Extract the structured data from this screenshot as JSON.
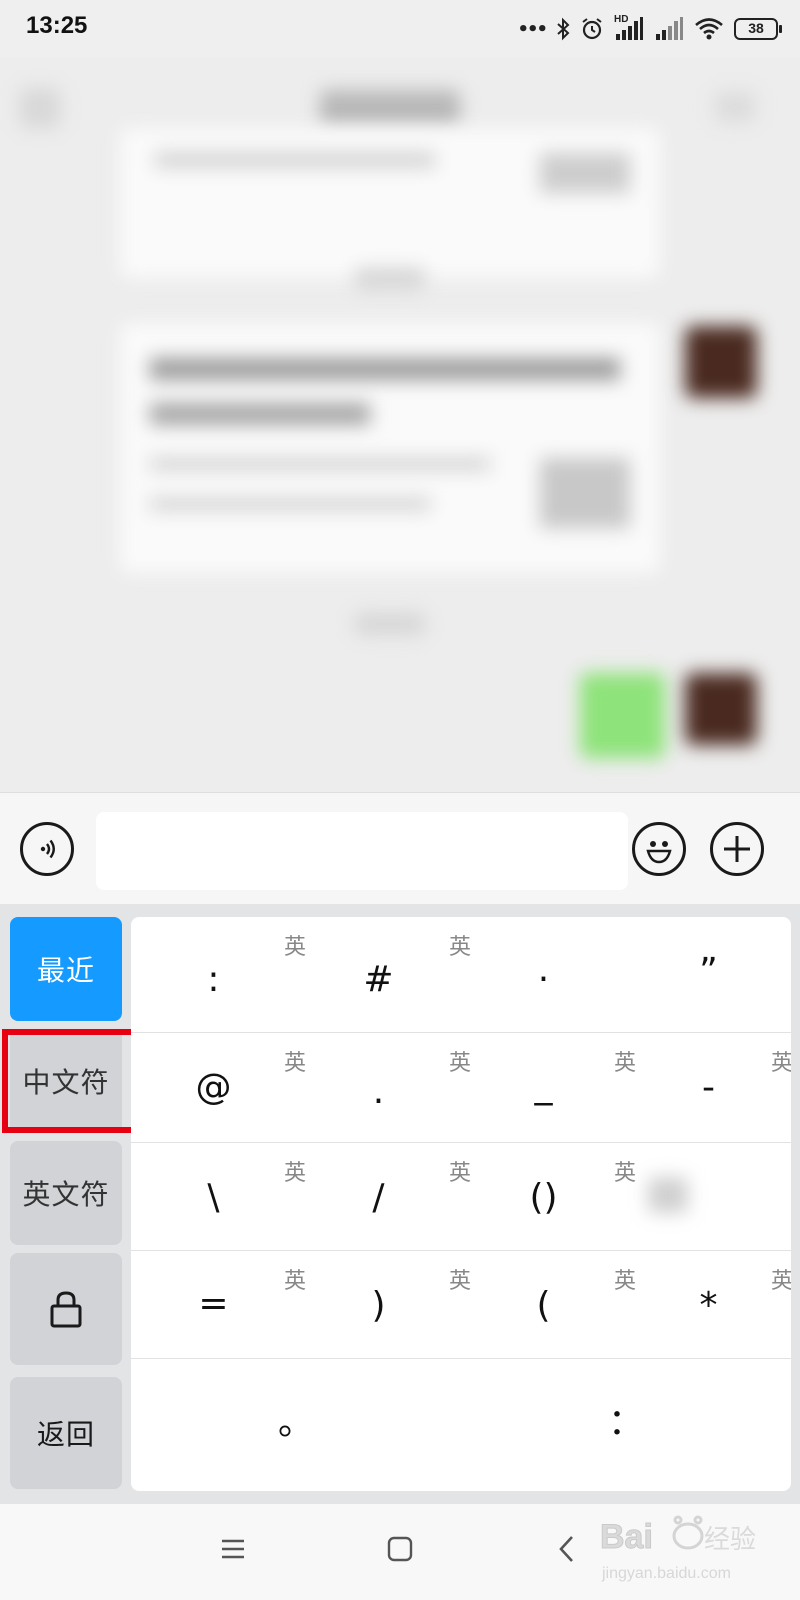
{
  "status_bar": {
    "time": "13:25",
    "dots": "•••",
    "network_label": "HD",
    "battery": "38",
    "icons": [
      "bluetooth-icon",
      "alarm-icon",
      "signal-hd-icon",
      "signal-icon",
      "wifi-icon",
      "battery-icon"
    ]
  },
  "input_bar": {
    "voice_icon": "voice-icon",
    "emoji_icon": "emoji-icon",
    "plus_icon": "plus-icon",
    "text_value": ""
  },
  "keyboard": {
    "side_tabs": [
      {
        "label": "最近",
        "active": true
      },
      {
        "label": "中文符",
        "active": false,
        "highlighted": true
      },
      {
        "label": "英文符",
        "active": false
      },
      {
        "label": "lock-icon",
        "active": false
      },
      {
        "label": "返回",
        "active": false
      }
    ],
    "english_tag": "英",
    "rows": [
      [
        {
          "sym": ":",
          "tag": "英"
        },
        {
          "sym": "#",
          "tag": "英"
        },
        {
          "sym": "·",
          "tag": ""
        },
        {
          "sym": "”",
          "tag": ""
        }
      ],
      [
        {
          "sym": "@",
          "tag": "英"
        },
        {
          "sym": ".",
          "tag": "英"
        },
        {
          "sym": "_",
          "tag": "英"
        },
        {
          "sym": "-",
          "tag": "英"
        }
      ],
      [
        {
          "sym": "\\",
          "tag": "英"
        },
        {
          "sym": "/",
          "tag": "英"
        },
        {
          "sym": "()",
          "tag": "英"
        },
        {
          "sym": "",
          "tag": ""
        }
      ],
      [
        {
          "sym": "=",
          "tag": "英"
        },
        {
          "sym": ")",
          "tag": "英"
        },
        {
          "sym": "(",
          "tag": "英"
        },
        {
          "sym": "*",
          "tag": "英"
        }
      ],
      [
        {
          "sym": "。",
          "tag": ""
        },
        {
          "sym": "",
          "tag": ""
        },
        {
          "sym": "：",
          "tag": ""
        },
        {
          "sym": "",
          "tag": ""
        }
      ]
    ]
  },
  "nav_bar": {
    "icons": [
      "menu-icon",
      "home-icon",
      "back-icon"
    ]
  },
  "colors": {
    "accent": "#159aff",
    "highlight": "#e60012"
  }
}
